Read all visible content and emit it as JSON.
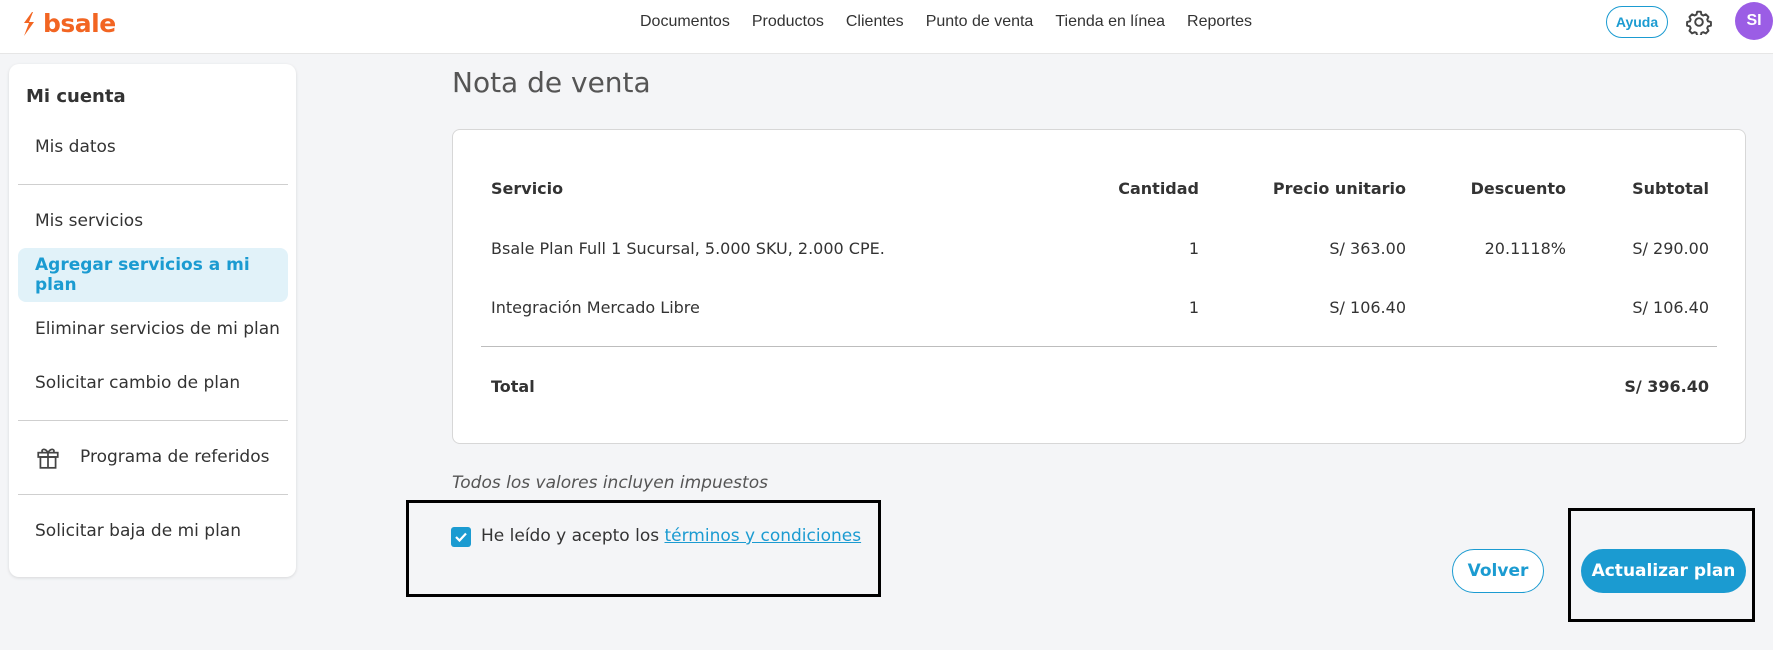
{
  "brand": {
    "name": "bsale",
    "color": "#f26522"
  },
  "topnav": [
    "Documentos",
    "Productos",
    "Clientes",
    "Punto de venta",
    "Tienda en línea",
    "Reportes"
  ],
  "header": {
    "help_label": "Ayuda",
    "avatar_initials": "SI",
    "settings_icon": "gear-icon"
  },
  "sidebar": {
    "title": "Mi cuenta",
    "items": [
      {
        "label": "Mis datos"
      },
      {
        "label": "Mis servicios"
      },
      {
        "label": "Agregar servicios a mi plan",
        "active": true
      },
      {
        "label": "Eliminar servicios de mi plan"
      },
      {
        "label": "Solicitar cambio de plan"
      },
      {
        "label": "Programa de referidos",
        "icon": "gift-icon"
      },
      {
        "label": "Solicitar baja de mi plan"
      }
    ]
  },
  "main": {
    "title": "Nota de venta",
    "table": {
      "headers": [
        "Servicio",
        "Cantidad",
        "Precio unitario",
        "Descuento",
        "Subtotal"
      ],
      "rows": [
        [
          "Bsale Plan Full 1 Sucursal, 5.000 SKU, 2.000 CPE.",
          "1",
          "S/ 363.00",
          "20.1118%",
          "S/ 290.00"
        ],
        [
          "Integración Mercado Libre",
          "1",
          "S/ 106.40",
          "",
          "S/ 106.40"
        ]
      ],
      "total_label": "Total",
      "total_value": "S/ 396.40"
    },
    "note": "Todos los valores incluyen impuestos",
    "terms": {
      "checked": true,
      "prefix": "He leído y acepto los ",
      "link": "términos y condiciones"
    },
    "buttons": {
      "back": "Volver",
      "update": "Actualizar plan"
    }
  },
  "colors": {
    "accent": "#1b9bd1",
    "avatar": "#9b5de5",
    "active_bg": "#e1f2f9"
  }
}
